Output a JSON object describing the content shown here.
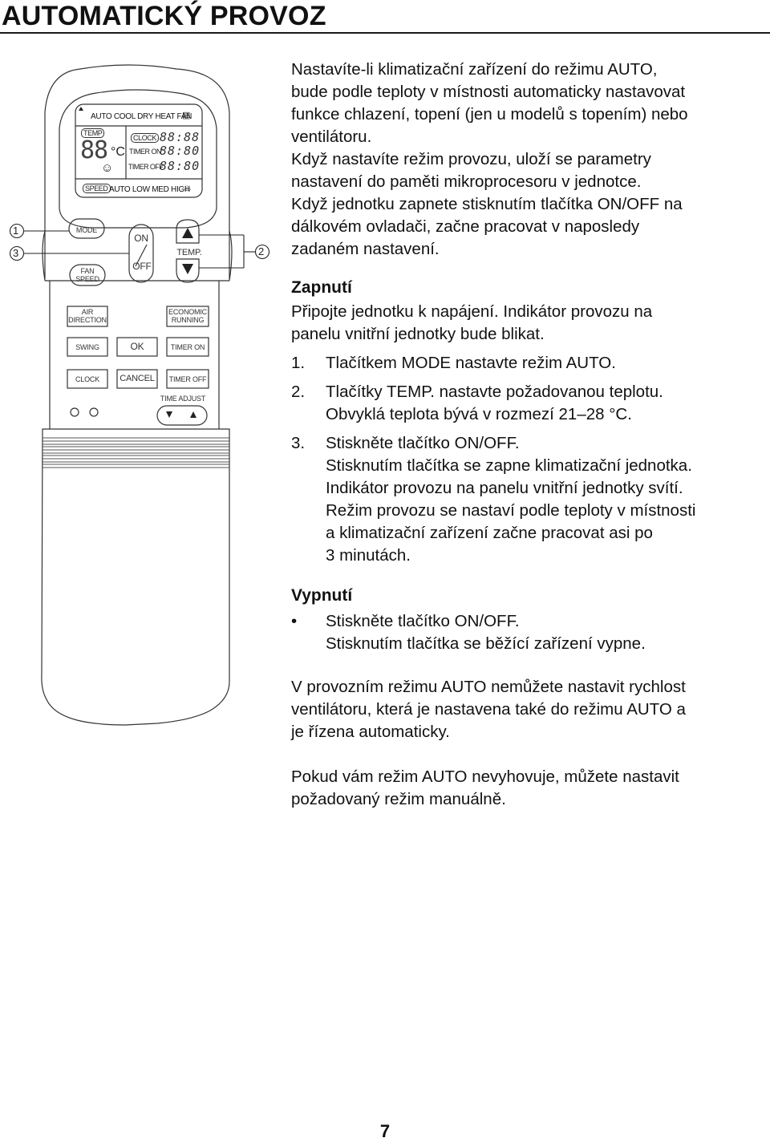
{
  "page": {
    "title": "AUTOMATICKÝ PROVOZ",
    "page_number": "7"
  },
  "remote": {
    "lcd": {
      "mode_row": "AUTO COOL DRY HEAT FAN",
      "temp_tag": "TEMP",
      "temp_digits": "88",
      "temp_unit": "°C",
      "clock_tag": "CLOCK",
      "clock_digits": "88:88",
      "timer_on_label": "TIMER ON",
      "timer_on_digits": "88:80",
      "timer_off_label": "TIMER OFF",
      "timer_off_digits": "88:80",
      "speed_tag": "SPEED",
      "speed_row": "AUTO LOW MED HIGH"
    },
    "buttons": {
      "mode": "MODE",
      "fan_speed_1": "FAN",
      "fan_speed_2": "SPEED",
      "on": "ON",
      "off": "OFF",
      "temp": "TEMP.",
      "air_direction_1": "AIR",
      "air_direction_2": "DIRECTION",
      "economic_running_1": "ECONOMIC",
      "economic_running_2": "RUNNING",
      "swing": "SWING",
      "ok": "OK",
      "timer_on": "TIMER ON",
      "clock": "CLOCK",
      "cancel": "CANCEL",
      "timer_off": "TIMER OFF",
      "time_adjust": "TIME ADJUST"
    },
    "callouts": [
      "1",
      "3",
      "2"
    ]
  },
  "content": {
    "intro": [
      "Nastavíte-li klimatizační zařízení do režimu AUTO,",
      "bude podle teploty v místnosti automaticky nastavovat",
      "funkce chlazení, topení (jen u modelů s topením) nebo",
      "ventilátoru.",
      "Když nastavíte režim provozu, uloží se parametry",
      "nastavení do paměti mikroprocesoru v jednotce.",
      "Když jednotku zapnete stisknutím tlačítka ON/OFF na",
      "dálkovém ovladači, začne pracovat v naposledy",
      "zadaném nastavení."
    ],
    "section_on": {
      "heading": "Zapnutí",
      "lead": [
        "Připojte jednotku k napájení. Indikátor provozu na",
        "panelu vnitřní jednotky bude blikat."
      ],
      "steps": [
        {
          "num": "1.",
          "lines": [
            "Tlačítkem MODE nastavte režim AUTO."
          ]
        },
        {
          "num": "2.",
          "lines": [
            "Tlačítky TEMP. nastavte požadovanou teplotu.",
            "Obvyklá teplota bývá v rozmezí 21–28 °C."
          ]
        },
        {
          "num": "3.",
          "lines": [
            "Stiskněte tlačítko ON/OFF.",
            "Stisknutím tlačítka se zapne klimatizační jednotka.",
            "Indikátor provozu na panelu vnitřní jednotky svítí.",
            "Režim provozu se nastaví podle teploty v místnosti",
            "a klimatizační zařízení začne pracovat asi po",
            "3 minutách."
          ]
        }
      ]
    },
    "section_off": {
      "heading": "Vypnutí",
      "bullet": "•",
      "lines": [
        "Stiskněte tlačítko ON/OFF.",
        "Stisknutím tlačítka se běžící zařízení vypne."
      ]
    },
    "note_fan": [
      "V provozním režimu AUTO nemůžete nastavit rychlost",
      "ventilátoru, která je nastavena také do režimu AUTO a",
      "je řízena automaticky."
    ],
    "note_manual": [
      "Pokud vám režim AUTO nevyhovuje, můžete nastavit",
      "požadovaný režim manuálně."
    ]
  }
}
